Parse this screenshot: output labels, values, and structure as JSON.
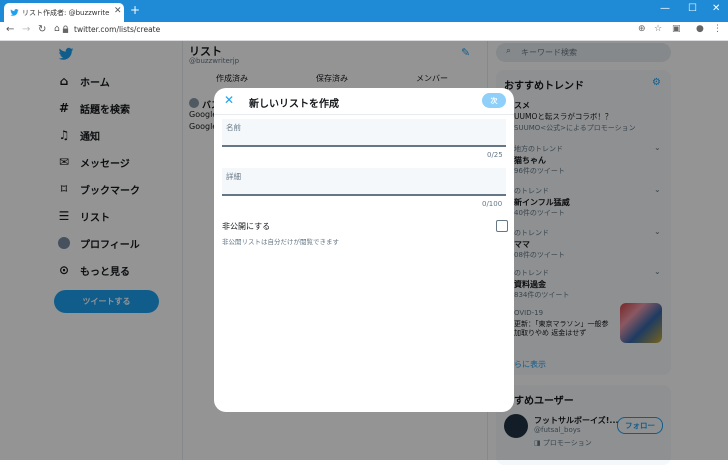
{
  "browser": {
    "tab_title": "リスト作成者: @buzzwriterjp / Tw",
    "url": "twitter.com/lists/create"
  },
  "sidebar": {
    "items": [
      {
        "label": "ホーム",
        "icon": "home-icon"
      },
      {
        "label": "話題を検索",
        "icon": "hash-icon"
      },
      {
        "label": "通知",
        "icon": "bell-icon"
      },
      {
        "label": "メッセージ",
        "icon": "mail-icon"
      },
      {
        "label": "ブックマーク",
        "icon": "bookmark-icon"
      },
      {
        "label": "リスト",
        "icon": "list-icon"
      },
      {
        "label": "プロフィール",
        "icon": "avatar-icon"
      },
      {
        "label": "もっと見る",
        "icon": "more-icon"
      }
    ],
    "tweet_button": "ツイートする"
  },
  "main": {
    "title": "リスト",
    "handle": "@buzzwriterjp",
    "tabs": [
      "作成済み",
      "保存済み",
      "メンバー"
    ],
    "partial_item_title": "バス",
    "partial_item_line1": "Google",
    "partial_item_line2": "Google"
  },
  "right": {
    "search_placeholder": "キーワード検索",
    "trends_title": "おすすめトレンド",
    "trends": [
      {
        "meta": "",
        "title": "スメ",
        "sub": "UUMOと転スラがコラボ！？"
      },
      {
        "meta": "",
        "title": "",
        "sub": "SUUMO<公式>によるプロモーション"
      },
      {
        "meta": "地方のトレンド",
        "title": "猫ちゃん",
        "sub": "96件のツイート"
      },
      {
        "meta": "のトレンド",
        "title": "新インフル猛威",
        "sub": "40件のツイート"
      },
      {
        "meta": "のトレンド",
        "title": "ママ",
        "sub": "08件のツイート"
      },
      {
        "meta": "のトレンド",
        "title": "資料過金",
        "sub": "834件のツイート"
      },
      {
        "meta": "OVID-19",
        "title": "",
        "sub": "更新：「東京マラソン」一般参 加取りやめ 返金はせず"
      }
    ],
    "more_link": "らに表示",
    "users_title": "すすめユーザー",
    "user": {
      "name": "フットサルボーイズ!...",
      "handle": "@futsal_boys",
      "promo": "プロモーション",
      "follow": "フォロー"
    }
  },
  "modal": {
    "title": "新しいリストを作成",
    "next_button": "次",
    "name_label": "名前",
    "name_count": "0/25",
    "desc_label": "詳細",
    "desc_count": "0/100",
    "private_label": "非公開にする",
    "private_help": "非公開リストは自分だけが閲覧できます"
  },
  "colors": {
    "accent": "#1da1f2",
    "titlebar": "#1f8ad6"
  }
}
